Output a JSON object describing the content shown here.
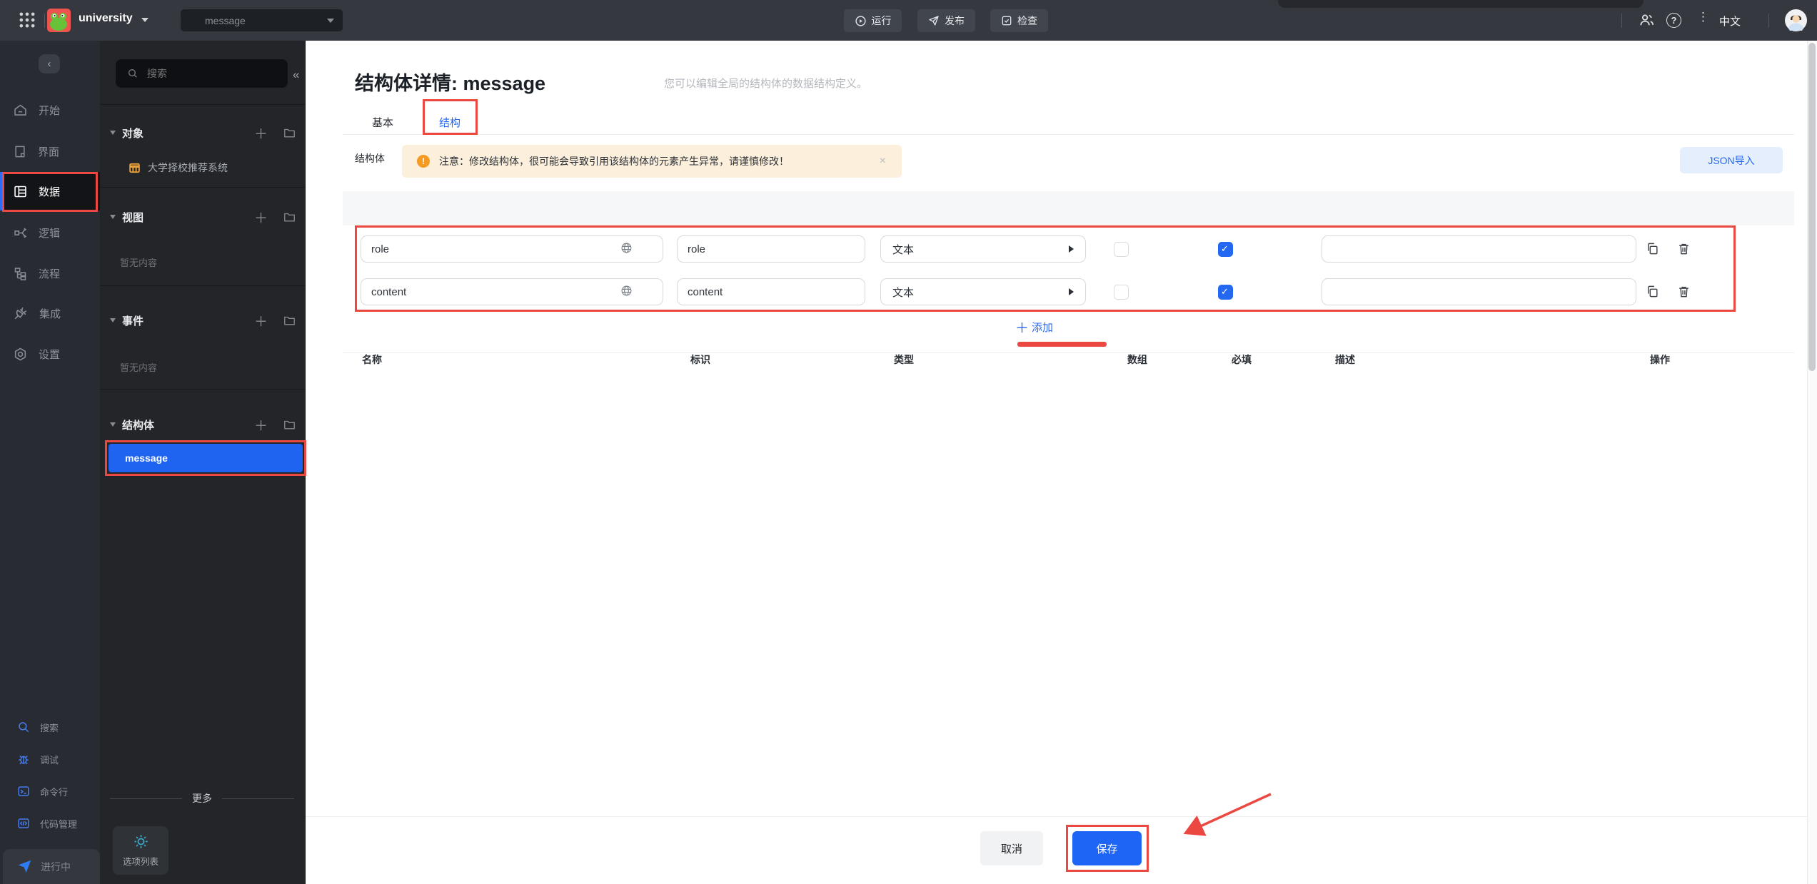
{
  "topbar": {
    "app_name": "university",
    "project_selector": "message",
    "run_label": "运行",
    "publish_label": "发布",
    "check_label": "检查",
    "language_label": "中文"
  },
  "sidebar": {
    "items": [
      {
        "label": "开始"
      },
      {
        "label": "界面"
      },
      {
        "label": "数据",
        "active": true
      },
      {
        "label": "逻辑"
      },
      {
        "label": "流程"
      },
      {
        "label": "集成"
      },
      {
        "label": "设置"
      }
    ],
    "tools": [
      {
        "label": "搜索"
      },
      {
        "label": "调试"
      },
      {
        "label": "命令行"
      },
      {
        "label": "代码管理"
      }
    ],
    "status_label": "进行中"
  },
  "panel": {
    "search_placeholder": "搜索",
    "sections": {
      "objects": {
        "title": "对象",
        "item": "大学择校推荐系统"
      },
      "views": {
        "title": "视图",
        "empty": "暂无内容"
      },
      "events": {
        "title": "事件",
        "empty": "暂无内容"
      },
      "structs": {
        "title": "结构体",
        "selected_item": "message"
      }
    },
    "more_label": "更多",
    "option_list_label": "选项列表"
  },
  "main": {
    "title": "结构体详情: message",
    "subtitle": "您可以编辑全局的结构体的数据结构定义。",
    "tabs": {
      "basic": "基本",
      "structure": "结构"
    },
    "active_tab": "结构",
    "field_label": "结构体",
    "notice_text": "注意：修改结构体，很可能会导致引用该结构体的元素产生异常，请谨慎修改！",
    "notice_close": "×",
    "json_import_label": "JSON导入",
    "table": {
      "headers": [
        "名称",
        "标识",
        "类型",
        "数组",
        "必填",
        "描述",
        "操作"
      ],
      "rows": [
        {
          "name": "role",
          "id": "role",
          "type": "文本",
          "array": false,
          "required": true,
          "desc": ""
        },
        {
          "name": "content",
          "id": "content",
          "type": "文本",
          "array": false,
          "required": true,
          "desc": ""
        }
      ]
    },
    "add_plus": "＋",
    "add_label": "添加",
    "footer": {
      "cancel_label": "取消",
      "save_label": "保存"
    }
  },
  "colors": {
    "accent": "#2468f2",
    "annotation": "#ec4842",
    "warning_bg": "#fcf0dd",
    "warning_icon": "#f59b23",
    "selected_item_bg": "#1f64f0"
  }
}
